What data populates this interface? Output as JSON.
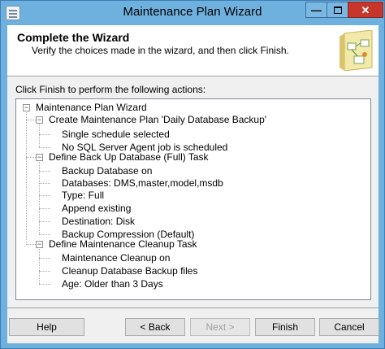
{
  "window": {
    "title": "Maintenance Plan Wizard",
    "minimize_glyph": "—",
    "close_glyph": "✕",
    "icon": "maintenance-plan-icon"
  },
  "header": {
    "title": "Complete the Wizard",
    "subtitle": "Verify the choices made in the wizard, and then click Finish."
  },
  "instructions": "Click Finish to perform the following actions:",
  "tree": {
    "root": "Maintenance Plan Wizard",
    "groups": [
      {
        "label": "Create Maintenance Plan 'Daily Database Backup'",
        "items": [
          "Single schedule selected",
          "No SQL Server Agent job is scheduled"
        ]
      },
      {
        "label": "Define Back Up Database (Full) Task",
        "items": [
          "Backup Database on",
          "Databases: DMS,master,model,msdb",
          "Type: Full",
          "Append existing",
          "Destination: Disk",
          "Backup Compression (Default)"
        ]
      },
      {
        "label": "Define Maintenance Cleanup Task",
        "items": [
          "Maintenance Cleanup on",
          "Cleanup Database Backup files",
          "Age: Older than 3 Days"
        ]
      }
    ],
    "toggle_glyph": "−"
  },
  "buttons": {
    "help": "Help",
    "back": "< Back",
    "next": "Next >",
    "finish": "Finish",
    "cancel": "Cancel"
  },
  "colors": {
    "titlebar": "#6fb1de",
    "close": "#c7362b"
  }
}
